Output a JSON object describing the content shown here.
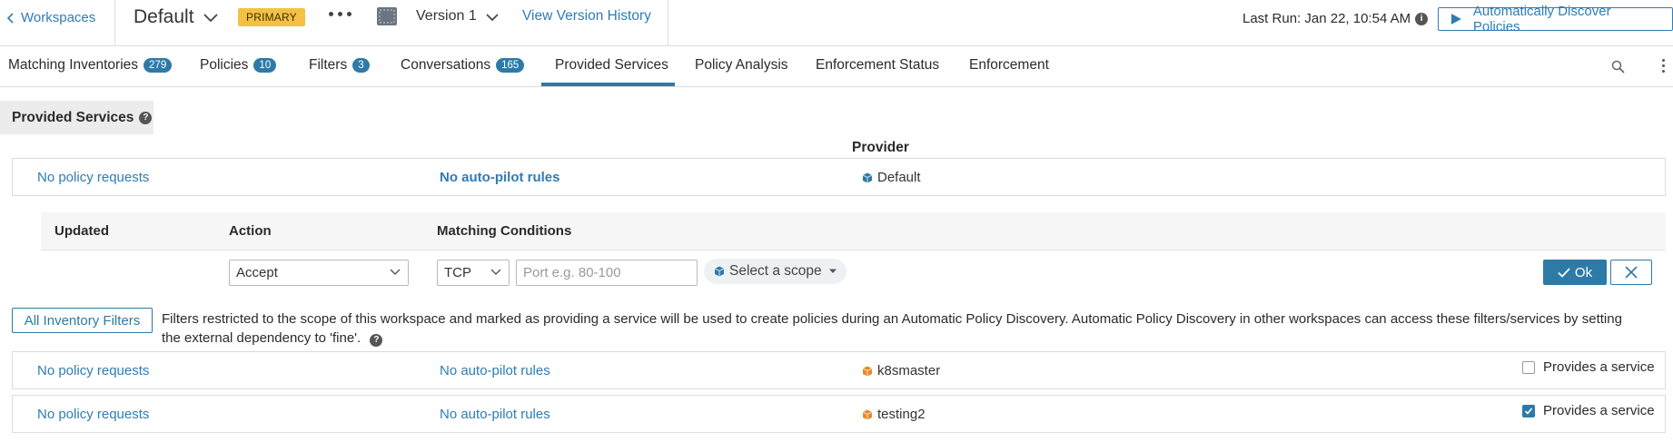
{
  "header": {
    "back_label": "Workspaces",
    "workspace_name": "Default",
    "primary_badge": "PRIMARY",
    "version_label": "Version 1",
    "version_history_link": "View Version History",
    "last_run": "Last Run: Jan 22, 10:54 AM",
    "discover_button": "Automatically Discover Policies"
  },
  "tabs": [
    {
      "label": "Matching Inventories",
      "count": "279"
    },
    {
      "label": "Policies",
      "count": "10"
    },
    {
      "label": "Filters",
      "count": "3"
    },
    {
      "label": "Conversations",
      "count": "165"
    },
    {
      "label": "Provided Services",
      "active": true
    },
    {
      "label": "Policy Analysis"
    },
    {
      "label": "Enforcement Status"
    },
    {
      "label": "Enforcement"
    }
  ],
  "section": {
    "title": "Provided Services",
    "provider_header": "Provider"
  },
  "default_row": {
    "policy_requests": "No policy requests",
    "autopilot": "No auto-pilot rules",
    "scope": "Default"
  },
  "rule_editor": {
    "col_updated": "Updated",
    "col_action": "Action",
    "col_conditions": "Matching Conditions",
    "action_value": "Accept",
    "protocol_value": "TCP",
    "port_placeholder": "Port e.g. 80-100",
    "scope_placeholder": "Select a scope",
    "ok_label": "Ok"
  },
  "filters_bar": {
    "button": "All Inventory Filters",
    "description": "Filters restricted to the scope of this workspace and marked as providing a service will be used to create policies during an Automatic Policy Discovery. Automatic Policy Discovery in other workspaces can access these filters/services by setting the external dependency to 'fine'."
  },
  "filter_rows": [
    {
      "policy_requests": "No policy requests",
      "autopilot": "No auto-pilot rules",
      "scope": "k8smaster",
      "provides_label": "Provides a service",
      "checked": false
    },
    {
      "policy_requests": "No policy requests",
      "autopilot": "No auto-pilot rules",
      "scope": "testing2",
      "provides_label": "Provides a service",
      "checked": true
    }
  ],
  "colors": {
    "accent": "#2e7aa7",
    "link": "#2f7cb5",
    "badge": "#f3c244",
    "scope_default": "#2e7aa7",
    "scope_filter": "#e5892a"
  }
}
